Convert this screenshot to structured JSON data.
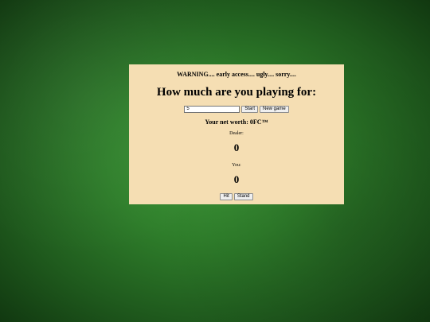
{
  "panel": {
    "warning": "WARNING.... early access.... ugly.... sorry....",
    "question": "How much are you playing for:",
    "bet_input_value": "5",
    "start_label": "Start",
    "new_game_label": "New game",
    "net_worth": "Your net worth: 0FC™",
    "dealer_label": "Dealer:",
    "dealer_score": "0",
    "you_label": "You:",
    "you_score": "0",
    "hit_label": "Hit",
    "stand_label": "Stand"
  },
  "colors": {
    "panel_background": "#f5deb3",
    "felt_green": "#2f7f2b"
  }
}
